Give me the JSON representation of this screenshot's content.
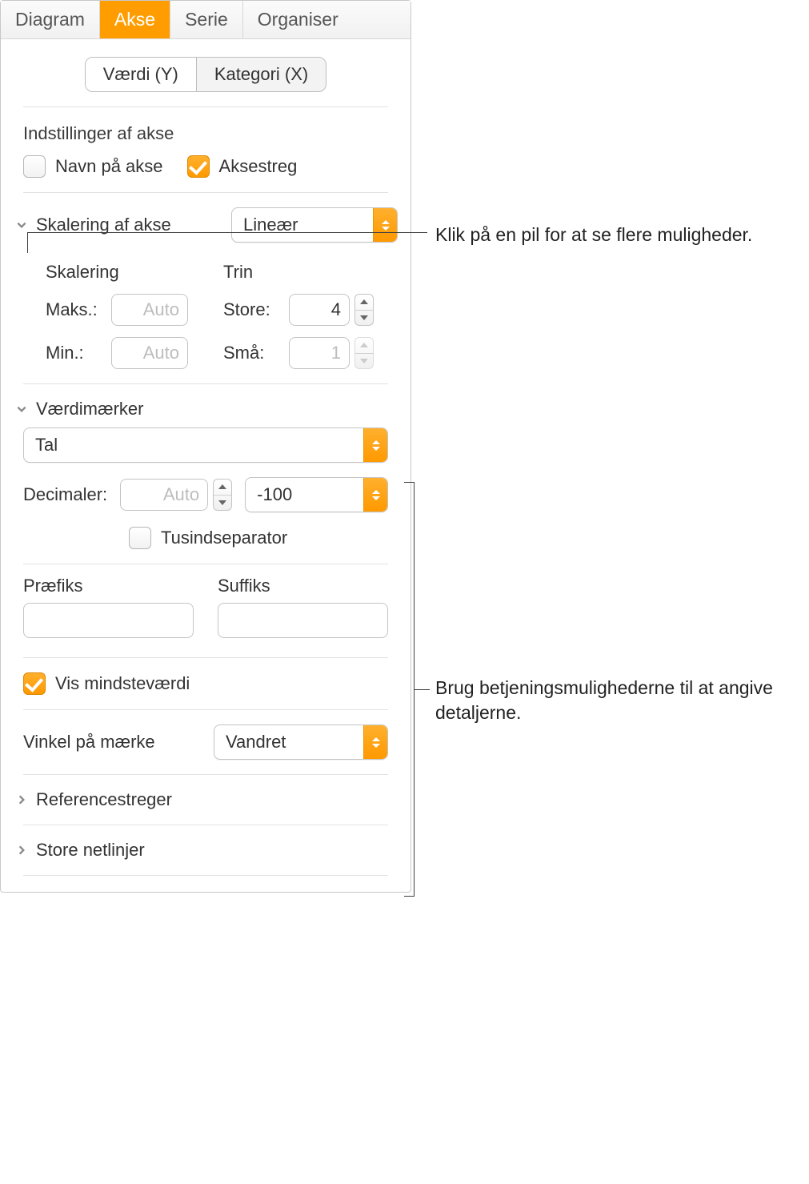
{
  "tabs": {
    "t0": "Diagram",
    "t1": "Akse",
    "t2": "Serie",
    "t3": "Organiser"
  },
  "seg": {
    "y": "Værdi (Y)",
    "x": "Kategori (X)"
  },
  "axis_settings": {
    "title": "Indstillinger af akse",
    "name_label": "Navn på akse",
    "line_label": "Aksestreg"
  },
  "scale": {
    "title": "Skalering af akse",
    "value": "Lineær",
    "scale_label": "Skalering",
    "steps_label": "Trin",
    "max": "Maks.:",
    "min": "Min.:",
    "major": "Store:",
    "minor": "Små:",
    "auto": "Auto",
    "major_val": "4",
    "minor_val": "1"
  },
  "labels": {
    "title": "Værdimærker",
    "format": "Tal",
    "decimals_label": "Decimaler:",
    "decimals_ph": "Auto",
    "negfmt": "-100",
    "thousand": "Tusindseparator",
    "prefix": "Præfiks",
    "suffix": "Suffiks",
    "show_min": "Vis mindsteværdi",
    "angle_label": "Vinkel på mærke",
    "angle_val": "Vandret"
  },
  "reflines": "Referencestreger",
  "gridlines": "Store netlinjer",
  "callout1": "Klik på en pil for at se flere muligheder.",
  "callout2": "Brug betjeningsmulighederne til at angive detaljerne."
}
